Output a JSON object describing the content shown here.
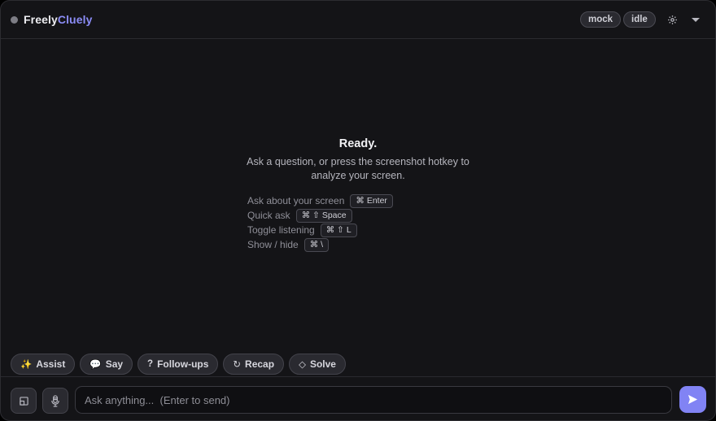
{
  "header": {
    "title_part1": "Freely",
    "title_part2": "Cluely",
    "mode_badge": "mock",
    "state_badge": "idle",
    "settings_icon": "gear-icon",
    "collapse_icon": "chevron-down-icon"
  },
  "empty_state": {
    "title": "Ready.",
    "description": "Ask a question, or press the screenshot hotkey to analyze your screen.",
    "shortcuts": [
      {
        "label": "Ask about your screen",
        "keys": "⌘ Enter"
      },
      {
        "label": "Quick ask",
        "keys": "⌘ ⇧ Space"
      },
      {
        "label": "Toggle listening",
        "keys": "⌘ ⇧ L"
      },
      {
        "label": "Show / hide",
        "keys": "⌘ \\"
      }
    ]
  },
  "actions": [
    {
      "icon": "✨",
      "label": "Assist"
    },
    {
      "icon": "💬",
      "label": "Say"
    },
    {
      "icon": "?",
      "label": "Follow-ups"
    },
    {
      "icon": "↻",
      "label": "Recap"
    },
    {
      "icon": "◇",
      "label": "Solve"
    }
  ],
  "composer": {
    "placeholder": "Ask anything...  (Enter to send)",
    "screenshot_icon": "screenshot-icon",
    "mic_icon": "microphone-icon",
    "send_icon": "send-icon"
  },
  "colors": {
    "accent": "#8183f4",
    "background": "#141417",
    "title_accent": "#8b8cf6"
  }
}
